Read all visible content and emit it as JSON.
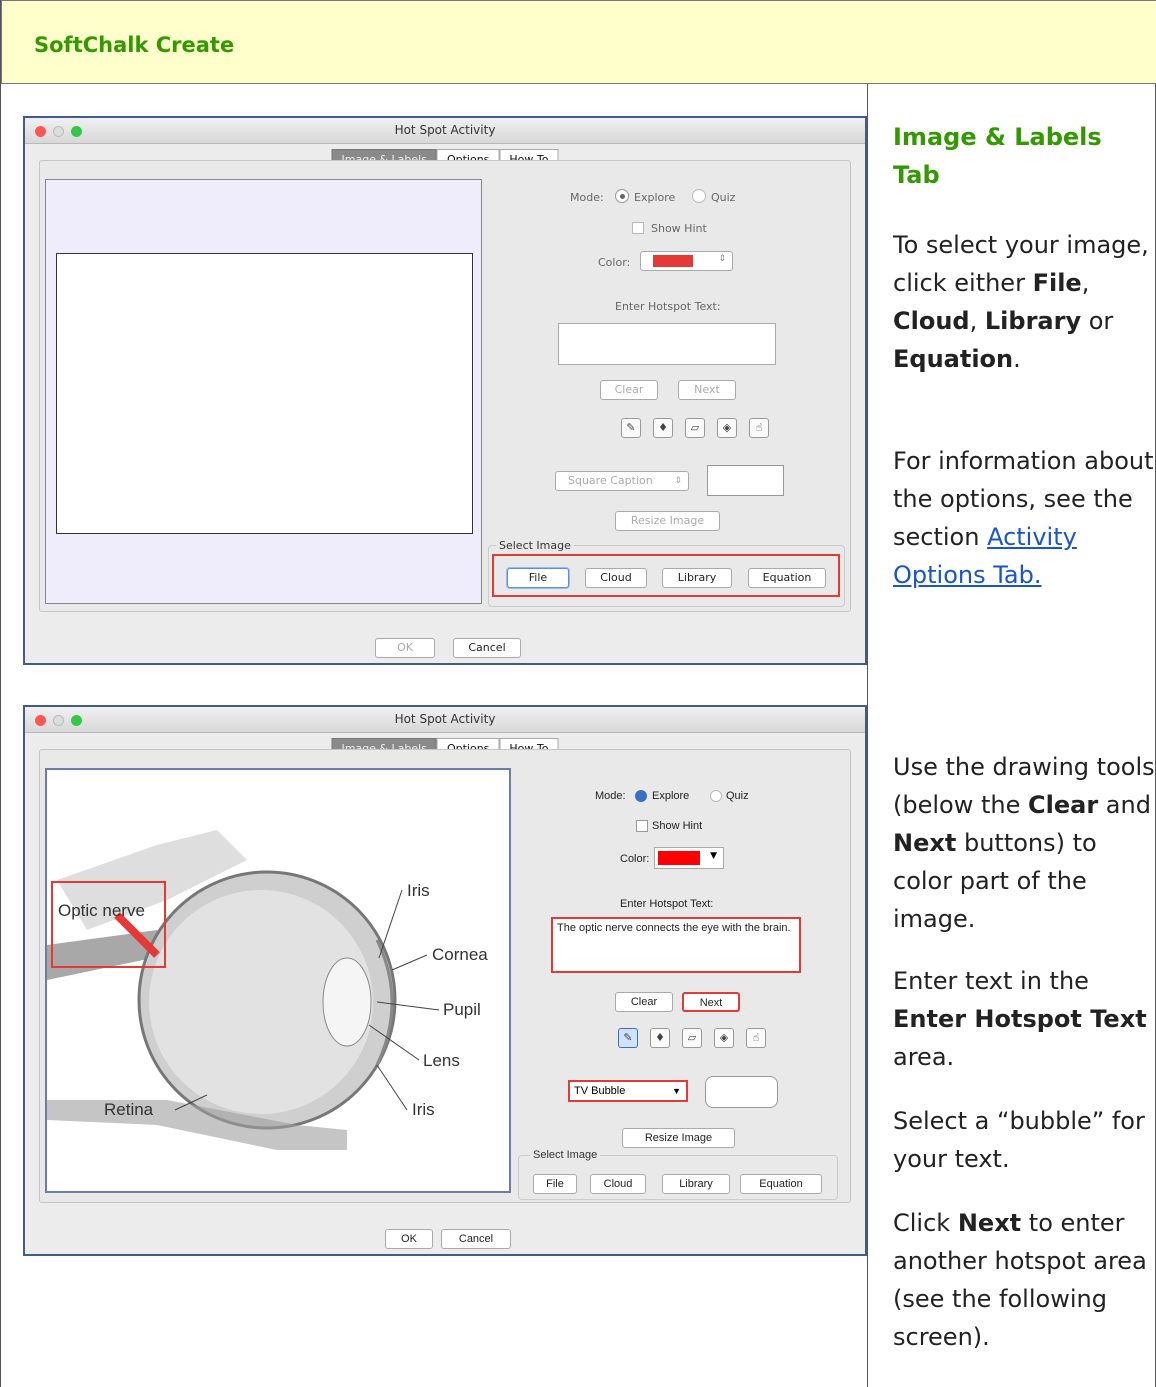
{
  "header": {
    "title": "SoftChalk Create"
  },
  "dialog": {
    "title": "Hot Spot Activity",
    "tabs": [
      "Image & Labels",
      "Options",
      "How To"
    ],
    "mode_label": "Mode:",
    "explore": "Explore",
    "quiz": "Quiz",
    "show_hint": "Show Hint",
    "color_label": "Color:",
    "enter_text_label": "Enter Hotspot Text:",
    "clear": "Clear",
    "next": "Next",
    "resize": "Resize Image",
    "select_image": "Select Image",
    "file": "File",
    "cloud": "Cloud",
    "library": "Library",
    "equation": "Equation",
    "ok": "OK",
    "cancel": "Cancel"
  },
  "shot1": {
    "caption_select": "Square Caption"
  },
  "shot2": {
    "caption_select": "TV Bubble",
    "hotspot_text": "The optic nerve connects the eye with the brain.",
    "eye_labels": {
      "optic": "Optic nerve",
      "iris_top": "Iris",
      "cornea": "Cornea",
      "pupil": "Pupil",
      "lens": "Lens",
      "retina": "Retina",
      "iris_bottom": "Iris"
    }
  },
  "side": {
    "heading": "Image & Labels Tab",
    "p1a": "To select your image, click either ",
    "file": "File",
    "comma": ", ",
    "cloud": "Cloud",
    "comma2": ",",
    "library": "Library",
    "or": " or ",
    "equation": "Equation",
    "dot": ".",
    "p2": "For information about the options, see the section ",
    "link": "Activity Options Tab.",
    "p3a": "Use the drawing tools (below the ",
    "clear": "Clear",
    "and": " and ",
    "next": "Next",
    "p3b": " buttons) to color part of the image.",
    "p4a": "Enter text in the ",
    "ehs": "Enter Hotspot Text",
    "p4b": " area.",
    "p5": "Select a “bubble” for your text.",
    "p6a": "Click ",
    "next2": "Next",
    "p6b": " to enter another hotspot area (see the following screen)."
  },
  "colors": {
    "green": "#339900",
    "header_bg": "#ffffcc",
    "red": "#e53935"
  }
}
